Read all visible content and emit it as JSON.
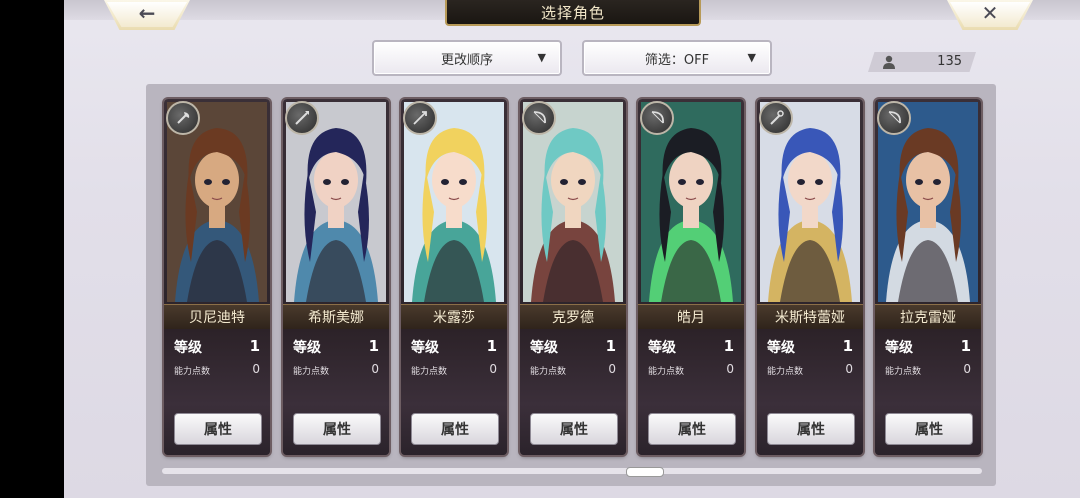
{
  "header": {
    "title": "选择角色",
    "back_icon": "←",
    "close_icon": "✕"
  },
  "toolbar": {
    "sort_label": "更改顺序",
    "filter_label": "筛选：OFF",
    "dropdown_arrow": "▼",
    "character_count": "135"
  },
  "characters": [
    {
      "name": "贝尼迪特",
      "level_label": "等级",
      "level": "1",
      "ap_label": "能力点数",
      "ap": "0",
      "attr_label": "属性",
      "class_icon": "axe-icon",
      "hair": "#6b3a22",
      "bg": "#5b4638",
      "skin": "#d7a981",
      "accent": "#2e5c86"
    },
    {
      "name": "希斯美娜",
      "level_label": "等级",
      "level": "1",
      "ap_label": "能力点数",
      "ap": "0",
      "attr_label": "属性",
      "class_icon": "spear-icon",
      "hair": "#24265a",
      "bg": "#c8c9cf",
      "skin": "#f0d2c4",
      "accent": "#3a7ea6"
    },
    {
      "name": "米露莎",
      "level_label": "等级",
      "level": "1",
      "ap_label": "能力点数",
      "ap": "0",
      "attr_label": "属性",
      "class_icon": "arrow-icon",
      "hair": "#f1d25e",
      "bg": "#d8e5ee",
      "skin": "#f7dccb",
      "accent": "#2f9a8a"
    },
    {
      "name": "克罗德",
      "level_label": "等级",
      "level": "1",
      "ap_label": "能力点数",
      "ap": "0",
      "attr_label": "属性",
      "class_icon": "bow-icon",
      "hair": "#6fc9c4",
      "bg": "#c7d4cf",
      "skin": "#f0d6c0",
      "accent": "#6a2a24"
    },
    {
      "name": "皓月",
      "level_label": "等级",
      "level": "1",
      "ap_label": "能力点数",
      "ap": "0",
      "attr_label": "属性",
      "class_icon": "bow-icon",
      "hair": "#1b1d24",
      "bg": "#2f6b5e",
      "skin": "#efd3c2",
      "accent": "#59e07a"
    },
    {
      "name": "米斯特蕾娅",
      "level_label": "等级",
      "level": "1",
      "ap_label": "能力点数",
      "ap": "0",
      "attr_label": "属性",
      "class_icon": "staff-icon",
      "hair": "#3957b8",
      "bg": "#d7dce6",
      "skin": "#f2d8c9",
      "accent": "#d3ad4a"
    },
    {
      "name": "拉克雷娅",
      "level_label": "等级",
      "level": "1",
      "ap_label": "能力点数",
      "ap": "0",
      "attr_label": "属性",
      "class_icon": "bow-icon",
      "hair": "#6a3a24",
      "bg": "#2d5a8c",
      "skin": "#e8c1a5",
      "accent": "#f1f1f1"
    }
  ]
}
